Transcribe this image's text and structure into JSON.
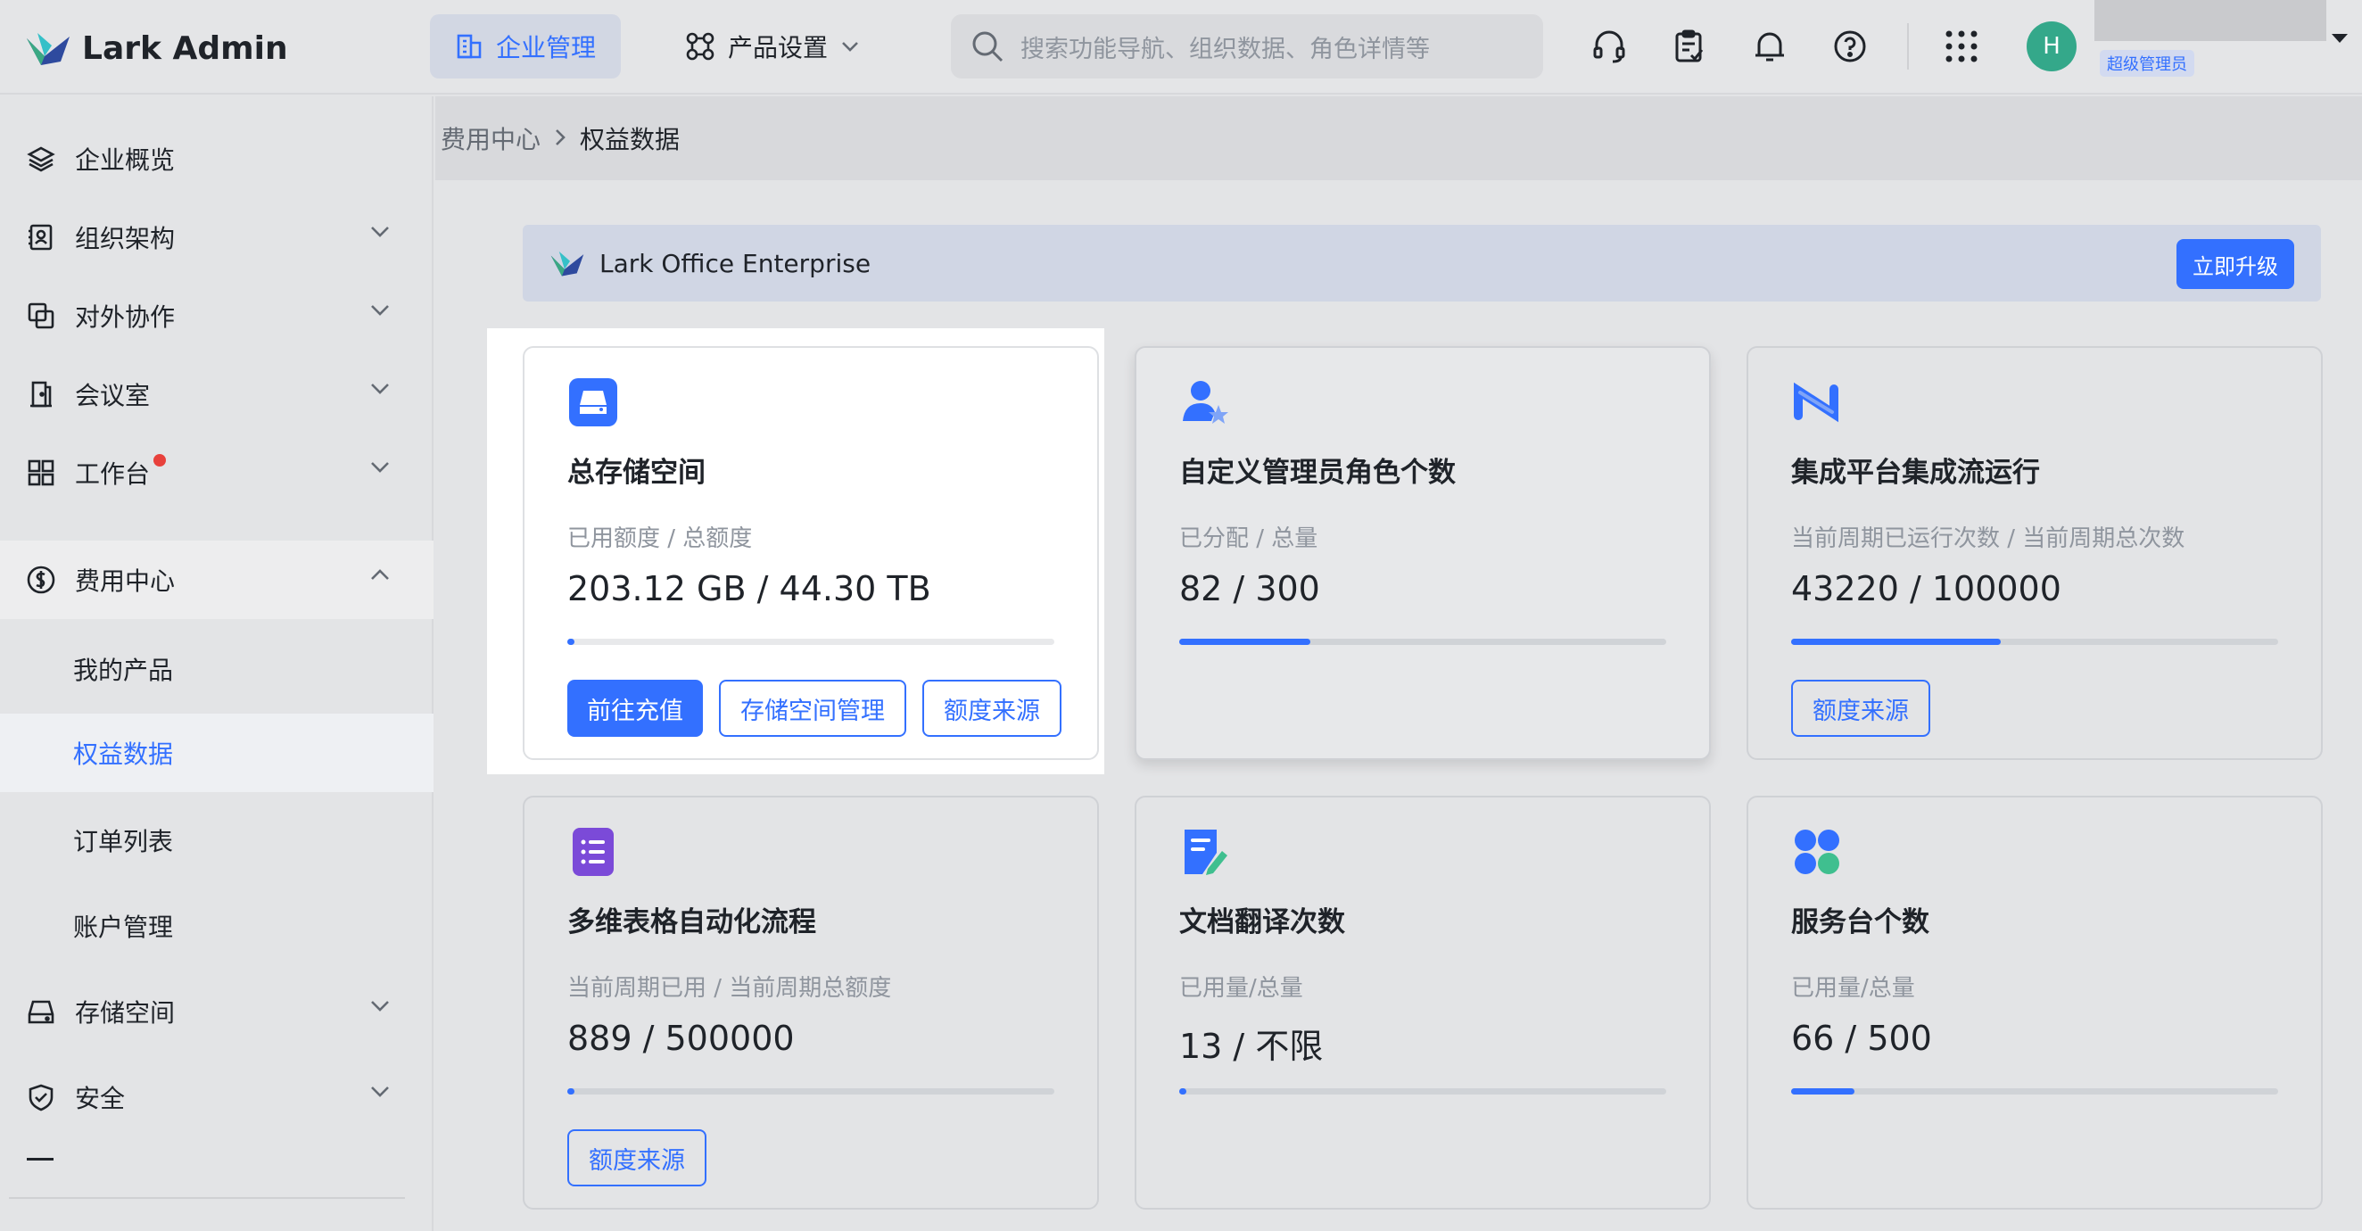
{
  "header": {
    "logo_text": "Lark Admin",
    "nav_active": "企业管理",
    "nav_product": "产品设置",
    "search_placeholder": "搜索功能导航、组织数据、角色详情等",
    "avatar_letter": "H",
    "role_badge": "超级管理员"
  },
  "sidebar": {
    "items": [
      {
        "label": "企业概览"
      },
      {
        "label": "组织架构"
      },
      {
        "label": "对外协作"
      },
      {
        "label": "会议室"
      },
      {
        "label": "工作台"
      },
      {
        "label": "费用中心"
      },
      {
        "label": "存储空间"
      },
      {
        "label": "安全"
      }
    ],
    "subitems": [
      {
        "label": "我的产品"
      },
      {
        "label": "权益数据"
      },
      {
        "label": "订单列表"
      },
      {
        "label": "账户管理"
      }
    ]
  },
  "breadcrumb": {
    "parent": "费用中心",
    "current": "权益数据"
  },
  "plan": {
    "name": "Lark Office Enterprise",
    "upgrade_label": "立即升级"
  },
  "cards": [
    {
      "title": "总存储空间",
      "label": "已用额度 / 总额度",
      "value": "203.12 GB / 44.30 TB",
      "progress": 0.014,
      "buttons": [
        "前往充值",
        "存储空间管理",
        "额度来源"
      ]
    },
    {
      "title": "自定义管理员角色个数",
      "label": "已分配 / 总量",
      "value": "82 / 300",
      "progress": 0.27
    },
    {
      "title": "集成平台集成流运行",
      "label": "当前周期已运行次数 / 当前周期总次数",
      "value": "43220 / 100000",
      "progress": 0.43,
      "buttons": [
        "额度来源"
      ]
    },
    {
      "title": "多维表格自动化流程",
      "label": "当前周期已用 / 当前周期总额度",
      "value": "889 / 500000",
      "progress": 0.015,
      "buttons": [
        "额度来源"
      ]
    },
    {
      "title": "文档翻译次数",
      "label": "已用量/总量",
      "value": "13 / 不限",
      "progress": 0.014
    },
    {
      "title": "服务台个数",
      "label": "已用量/总量",
      "value": "66 / 500",
      "progress": 0.13
    }
  ],
  "colors": {
    "accent": "#3370ff",
    "alert_dot": "#e8413c"
  }
}
